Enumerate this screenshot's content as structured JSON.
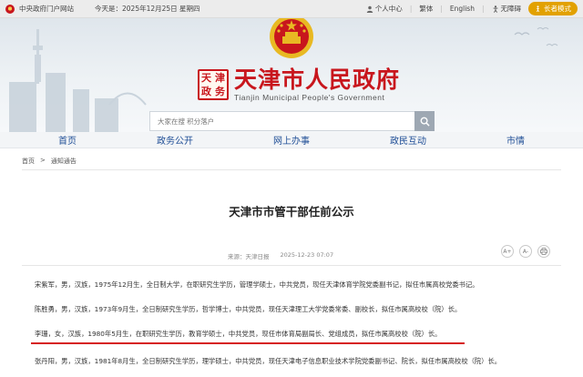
{
  "topbar": {
    "portal": "中央政府门户网站",
    "date": "今天是：2025年12月25日 星期四",
    "personal": "个人中心",
    "traditional": "繁体",
    "english": "English",
    "accessibility": "无障碍",
    "elder_mode": "长者模式"
  },
  "header": {
    "seal_chars": [
      "天",
      "津",
      "政",
      "务"
    ],
    "site_name": "天津市人民政府",
    "site_name_en": "Tianjin Municipal People's Government"
  },
  "search": {
    "placeholder": "大家在搜 积分落户"
  },
  "nav": {
    "items": [
      "首页",
      "政务公开",
      "网上办事",
      "政民互动",
      "市情"
    ]
  },
  "breadcrumb": {
    "home": "首页",
    "sep": ">",
    "current": "通知通告"
  },
  "article": {
    "title": "天津市市管干部任前公示",
    "source": "来源：天津日报",
    "date": "2025-12-23 07:07",
    "tools": [
      "A+",
      "A-",
      "print"
    ],
    "paragraphs": [
      "宋紫军，男，汉族，1975年12月生，全日制大学，在职研究生学历，管理学硕士，中共党员，现任天津体育学院党委副书记，拟任市属高校党委书记。",
      "陈胜勇，男，汉族，1973年9月生，全日制研究生学历，哲学博士，中共党员，现任天津理工大学党委常委、副校长，拟任市属高校校（院）长。",
      "李珊，女，汉族，1980年5月生，在职研究生学历，教育学硕士，中共党员，现任市体育局副局长、党组成员，拟任市属高校校（院）长。",
      "张丹阳，男，汉族，1981年8月生，全日制研究生学历，理学硕士，中共党员，现任天津电子信息职业技术学院党委副书记、院长，拟任市属高校校（院）长。"
    ]
  },
  "colors": {
    "brand_red": "#c8161d",
    "nav_blue": "#1f4e96",
    "highlight_red": "#d61d1d",
    "elder_button": "#e2a100"
  }
}
